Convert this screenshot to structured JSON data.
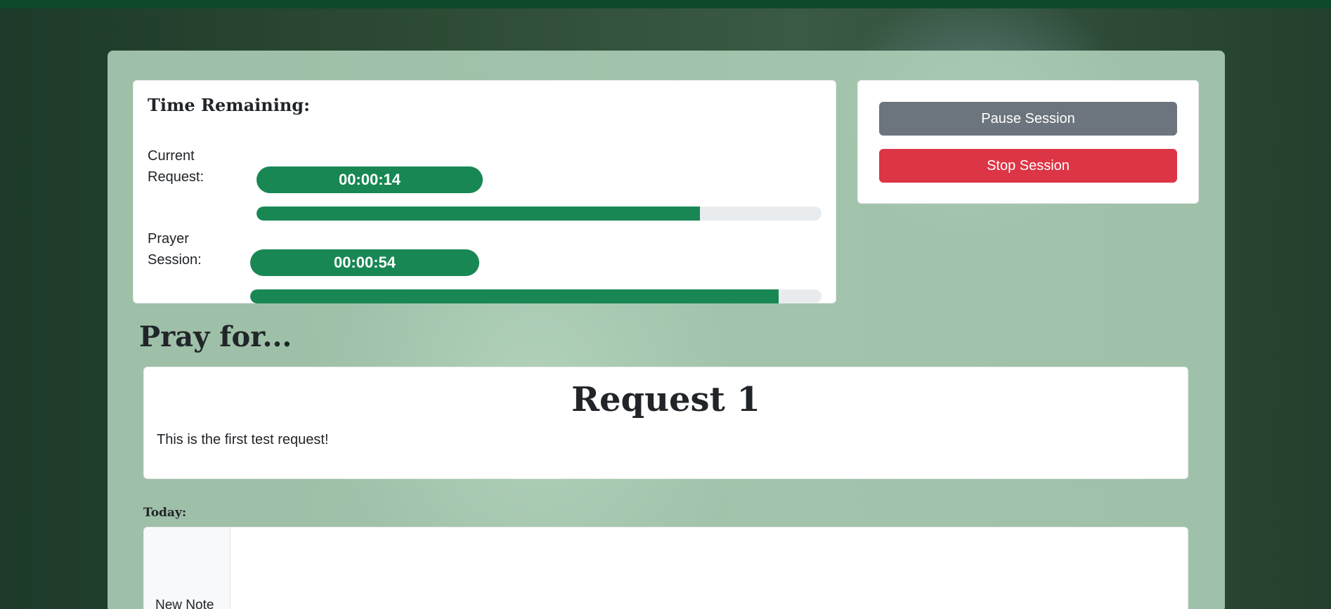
{
  "timer": {
    "title": "Time Remaining:",
    "current_request": {
      "label": "Current Request:",
      "time": "00:00:14",
      "progress": 0.785
    },
    "prayer_session": {
      "label": "Prayer Session:",
      "time": "00:00:54",
      "progress": 0.925
    }
  },
  "controls": {
    "pause_label": "Pause Session",
    "stop_label": "Stop Session"
  },
  "pray_for": {
    "heading": "Pray for...",
    "request_title": "Request 1",
    "request_body": "This is the first test request!"
  },
  "notes": {
    "section_label": "Today:",
    "new_note_label": "New Note"
  },
  "colors": {
    "success": "#198754",
    "secondary": "#6c757d",
    "danger": "#dc3545",
    "top_bar": "#0f4a2a"
  }
}
